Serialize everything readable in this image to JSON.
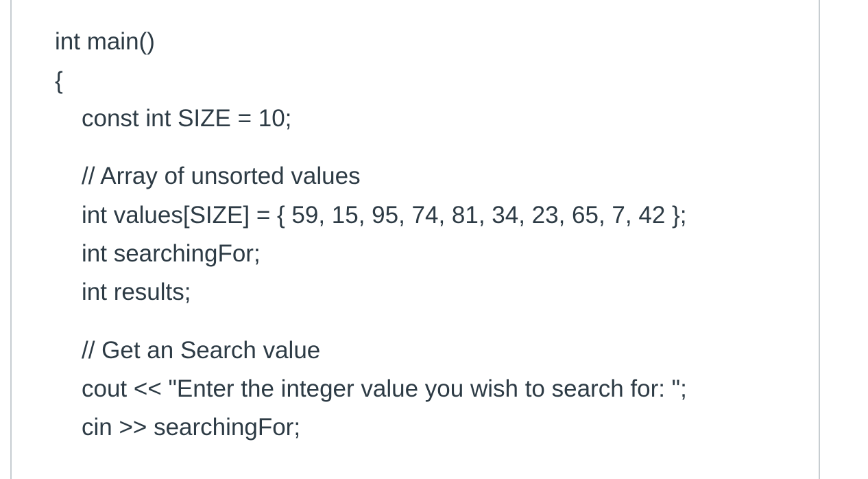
{
  "code": {
    "lines": [
      "int main()",
      "{",
      "const int SIZE = 10;",
      "// Array of unsorted values",
      "int values[SIZE] = { 59, 15, 95, 74, 81, 34, 23, 65, 7, 42 };",
      "int searchingFor;",
      "int results;",
      "// Get an Search value",
      "cout << \"Enter the integer value you wish to search for: \";",
      "cin >> searchingFor;"
    ]
  }
}
